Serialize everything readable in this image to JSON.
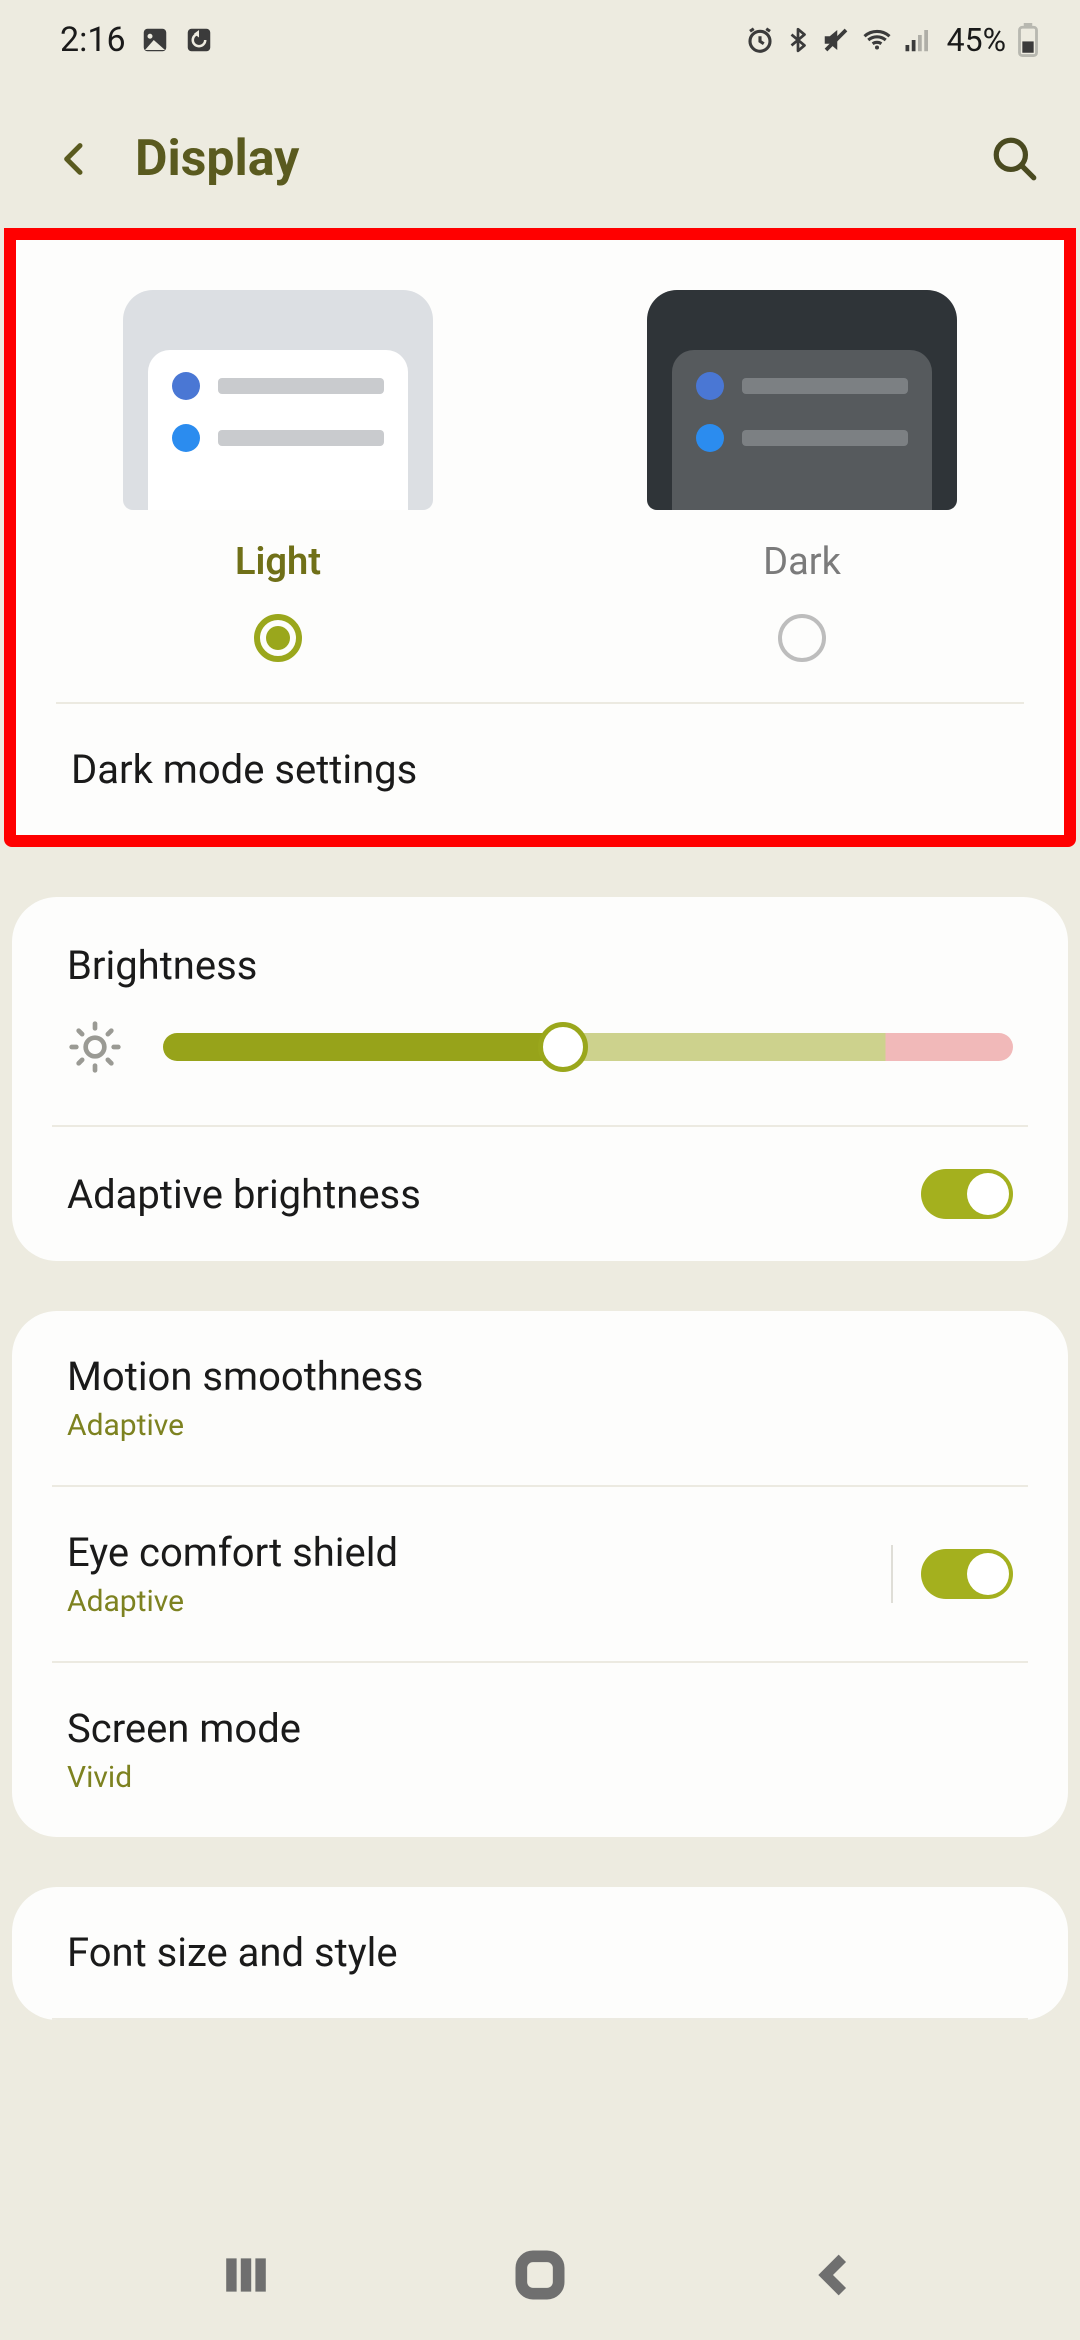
{
  "status": {
    "time": "2:16",
    "battery": "45%"
  },
  "header": {
    "title": "Display"
  },
  "theme": {
    "light_label": "Light",
    "dark_label": "Dark",
    "selected": "light",
    "settings_link": "Dark mode settings"
  },
  "brightness": {
    "label": "Brightness",
    "value_percent": 47,
    "adaptive_label": "Adaptive brightness",
    "adaptive_on": true
  },
  "motion": {
    "label": "Motion smoothness",
    "value": "Adaptive"
  },
  "eye_comfort": {
    "label": "Eye comfort shield",
    "value": "Adaptive",
    "on": true
  },
  "screen_mode": {
    "label": "Screen mode",
    "value": "Vivid"
  },
  "font": {
    "label": "Font size and style"
  }
}
